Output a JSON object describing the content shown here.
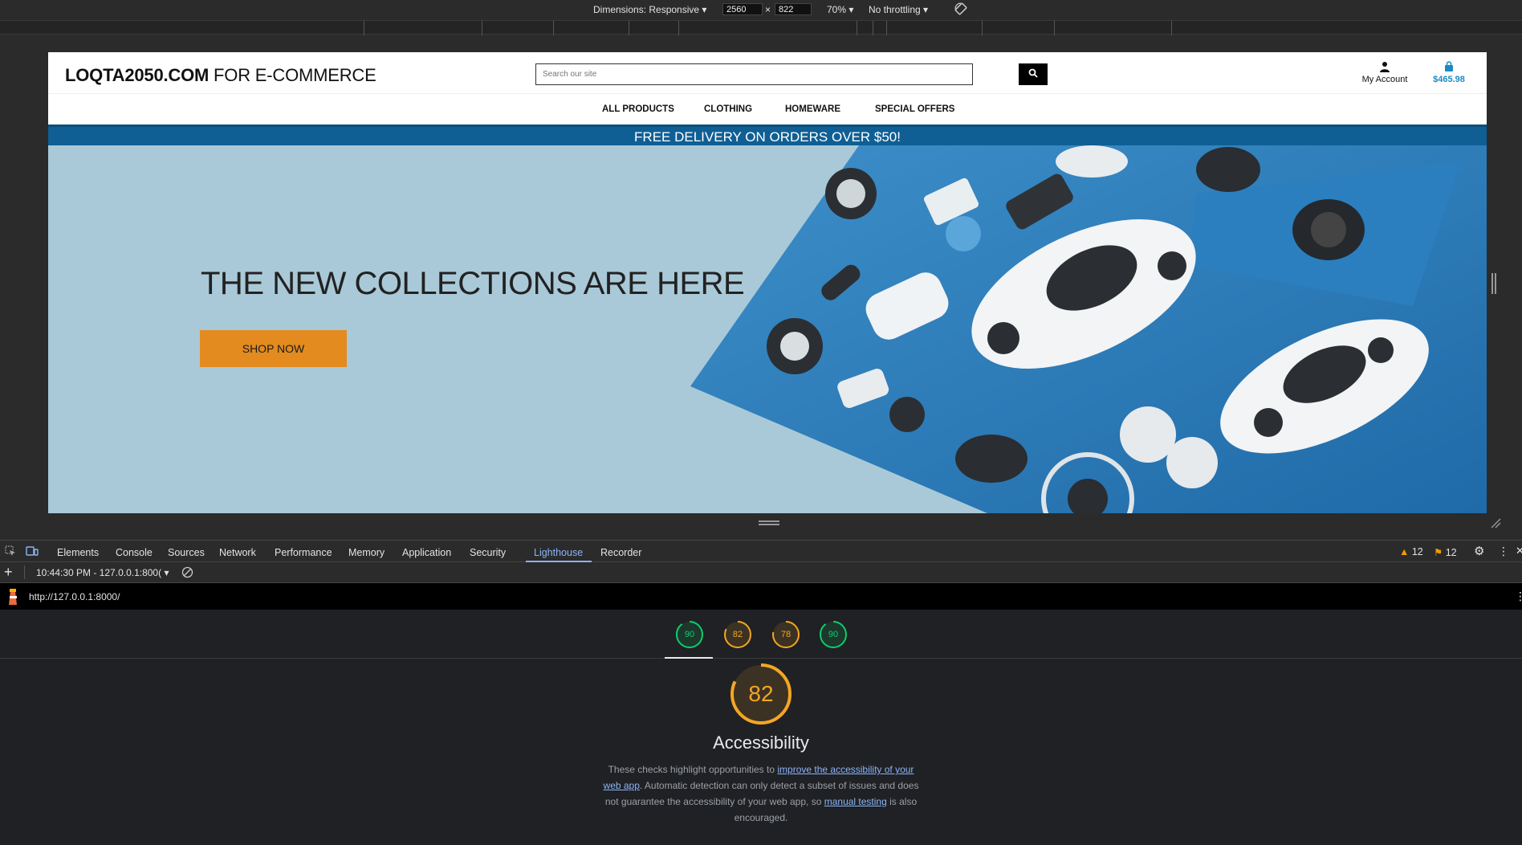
{
  "devtools_toolbar": {
    "dimensions_label": "Dimensions: Responsive",
    "width": "2560",
    "times": "×",
    "height": "822",
    "zoom": "70%",
    "throttling": "No throttling"
  },
  "site": {
    "logo_bold": "LOQTA2050.COM",
    "logo_rest": " FOR E-COMMERCE",
    "search_placeholder": "Search our site",
    "account_label": "My Account",
    "cart_total": "$465.98",
    "nav": [
      "ALL PRODUCTS",
      "CLOTHING",
      "HOMEWARE",
      "SPECIAL OFFERS"
    ],
    "promo": "FREE DELIVERY ON ORDERS OVER $50!",
    "hero_heading": "THE NEW COLLECTIONS ARE HERE",
    "hero_button": "SHOP NOW"
  },
  "devtools": {
    "tabs": [
      "Elements",
      "Console",
      "Sources",
      "Network",
      "Performance",
      "Memory",
      "Application",
      "Security",
      "Lighthouse",
      "Recorder"
    ],
    "active_tab": "Lighthouse",
    "warnings": "12",
    "issues": "12",
    "report_selector": "10:44:30 PM - 127.0.0.1:800(",
    "url": "http://127.0.0.1:8000/"
  },
  "lighthouse": {
    "scores": [
      {
        "value": "90",
        "fraction": 0.9,
        "color": "#0cce6b"
      },
      {
        "value": "82",
        "fraction": 0.82,
        "color": "#f5a623"
      },
      {
        "value": "78",
        "fraction": 0.78,
        "color": "#f5a623"
      },
      {
        "value": "90",
        "fraction": 0.9,
        "color": "#0cce6b"
      }
    ],
    "main_score": {
      "value": "82",
      "fraction": 0.82,
      "color": "#f5a623"
    },
    "category": "Accessibility",
    "desc_1": "These checks highlight opportunities to ",
    "desc_link_1": "improve the accessibility of your web app",
    "desc_2": ". Automatic detection can only detect a subset of issues and does not guarantee the accessibility of your web app, so ",
    "desc_link_2": "manual testing",
    "desc_3": " is also encouraged."
  }
}
